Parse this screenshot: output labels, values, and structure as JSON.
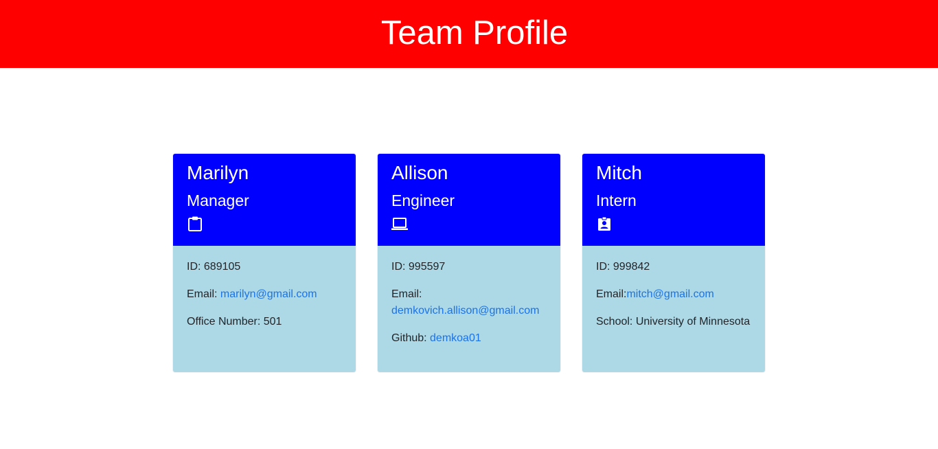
{
  "header": {
    "title": "Team Profile"
  },
  "colors": {
    "banner": "#ff0000",
    "card_header": "#0000ff",
    "card_body": "#add8e6",
    "link": "#1a73e8"
  },
  "cards": [
    {
      "name": "Marilyn",
      "role": "Manager",
      "icon": "clipboard-icon",
      "id_text": "ID: 689105",
      "email_label": "Email: ",
      "email": "marilyn@gmail.com",
      "extra_label": "Office Number: 501"
    },
    {
      "name": "Allison",
      "role": "Engineer",
      "icon": "laptop-icon",
      "id_text": "ID: 995597",
      "email_label": "Email:",
      "email": "demkovich.allison@gmail.com",
      "extra_label": "Github: ",
      "extra_link": "demkoa01"
    },
    {
      "name": "Mitch",
      "role": "Intern",
      "icon": "badge-icon",
      "id_text": "ID: 999842",
      "email_label": "Email:",
      "email": "mitch@gmail.com",
      "extra_label": "School: University of Minnesota"
    }
  ]
}
